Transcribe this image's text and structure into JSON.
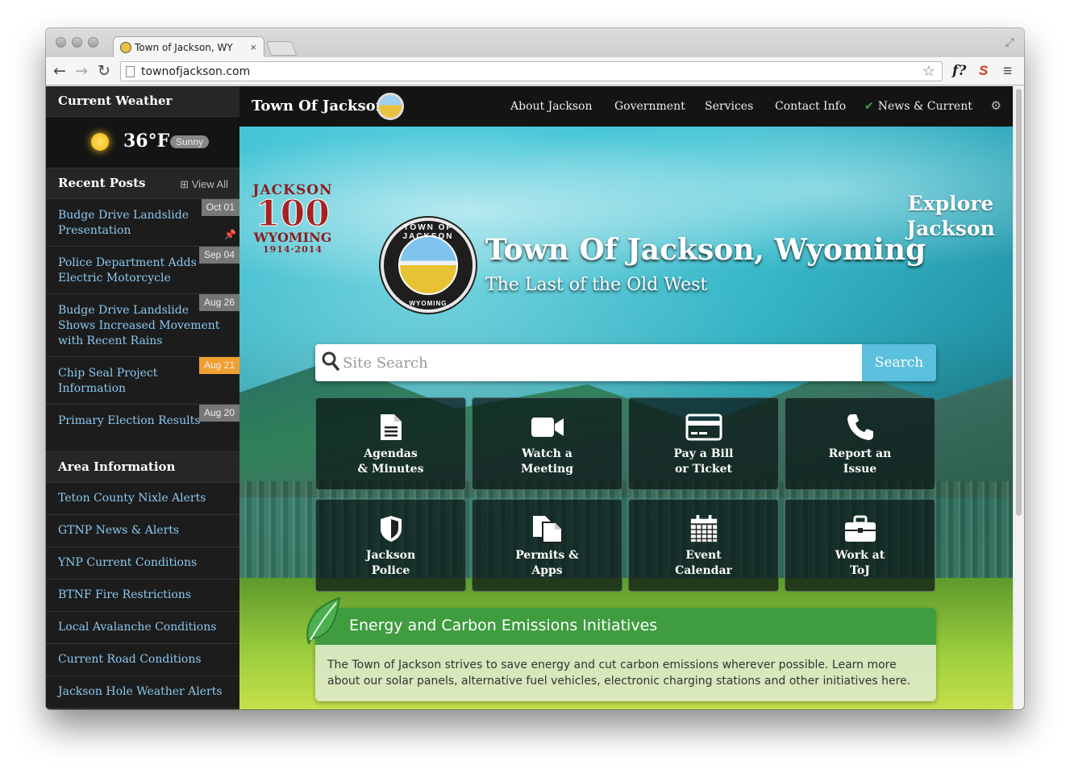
{
  "browser": {
    "tab_title": "Town of Jackson, WY",
    "tab_close": "×",
    "url": "townofjackson.com",
    "ext_f": "f?",
    "ext_s": "S",
    "menu": "≡"
  },
  "sidebar": {
    "weather_title": "Current Weather",
    "temperature": "36°F",
    "condition": "Sunny",
    "recent_title": "Recent Posts",
    "view_all": "View All",
    "posts": [
      {
        "title": "Budge Drive Landslide Presentation",
        "date": "Oct 01",
        "highlight": false
      },
      {
        "title": "Police Department Adds Electric Motorcycle",
        "date": "Sep 04",
        "highlight": false
      },
      {
        "title": "Budge Drive Landslide Shows Increased Movement with Recent Rains",
        "date": "Aug 26",
        "highlight": false
      },
      {
        "title": "Chip Seal Project Information",
        "date": "Aug 21",
        "highlight": true
      },
      {
        "title": "Primary Election Results",
        "date": "Aug 20",
        "highlight": false
      }
    ],
    "area_title": "Area Information",
    "area_items": [
      "Teton County Nixle Alerts",
      "GTNP News & Alerts",
      "YNP Current Conditions",
      "BTNF Fire Restrictions",
      "Local Avalanche Conditions",
      "Current Road Conditions",
      "Jackson Hole Weather Alerts"
    ]
  },
  "nav": {
    "brand": "Town Of Jackson",
    "links": [
      "About Jackson",
      "Government",
      "Services",
      "Contact Info",
      "News & Current"
    ]
  },
  "hero": {
    "centennial": {
      "line1": "JACKSON",
      "line2": "100",
      "line3": "WYOMING",
      "line4": "1914·2014"
    },
    "seal_top": "TOWN OF JACKSON",
    "seal_bottom": "WYOMING",
    "title": "Town Of Jackson, Wyoming",
    "subtitle": "The Last of the Old West",
    "explore_line1": "Explore",
    "explore_line2": "Jackson"
  },
  "search": {
    "placeholder": "Site Search",
    "button": "Search"
  },
  "tiles": [
    {
      "line1": "Agendas",
      "line2": "& Minutes",
      "icon": "document-icon"
    },
    {
      "line1": "Watch a",
      "line2": "Meeting",
      "icon": "video-camera-icon"
    },
    {
      "line1": "Pay a Bill",
      "line2": "or Ticket",
      "icon": "credit-card-icon"
    },
    {
      "line1": "Report an",
      "line2": "Issue",
      "icon": "phone-icon"
    },
    {
      "line1": "Jackson",
      "line2": "Police",
      "icon": "shield-icon"
    },
    {
      "line1": "Permits &",
      "line2": "Apps",
      "icon": "files-icon"
    },
    {
      "line1": "Event",
      "line2": "Calendar",
      "icon": "calendar-icon"
    },
    {
      "line1": "Work at",
      "line2": "ToJ",
      "icon": "briefcase-icon"
    }
  ],
  "energy": {
    "title": "Energy and Carbon Emissions Initiatives",
    "text": "The Town of Jackson strives to save energy and cut carbon emissions wherever possible. Learn more about our solar panels, alternative fuel vehicles, electronic charging stations and other initiatives here."
  },
  "colors": {
    "accent_blue": "#5bc0de",
    "green_bar": "#3f9c3f",
    "link_blue": "#8cc8f0",
    "date_highlight": "#f0a030"
  }
}
